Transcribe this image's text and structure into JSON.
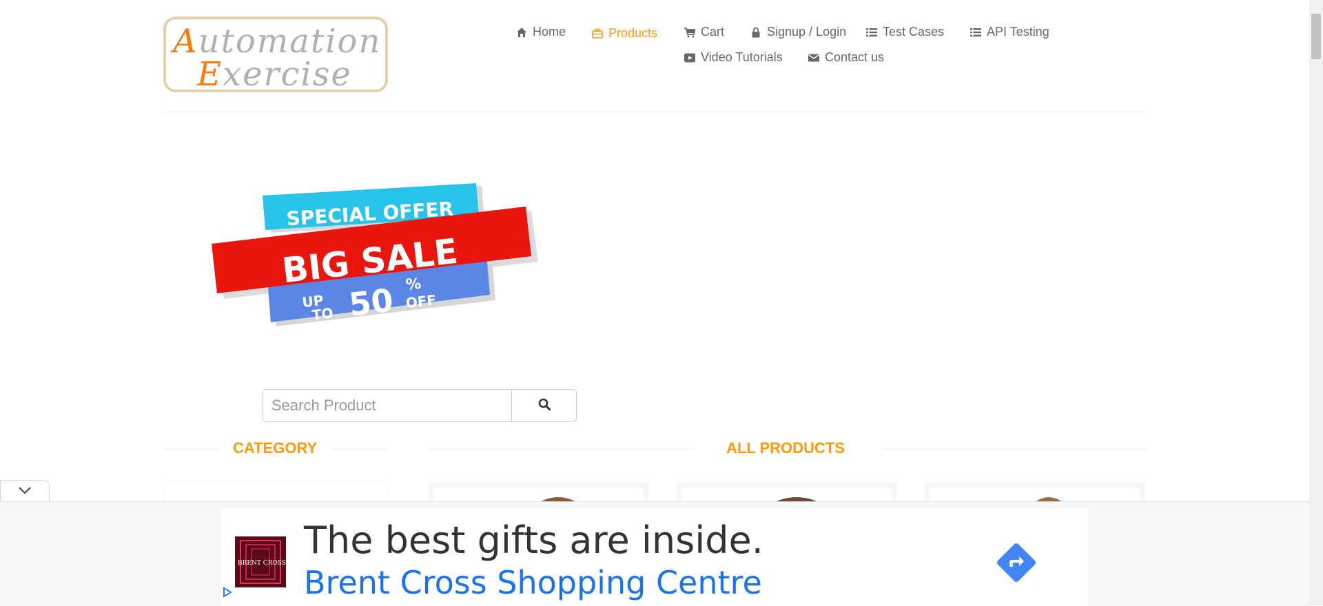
{
  "logo": {
    "line1_cap": "A",
    "line1_rest": "utomation",
    "line2_cap": "E",
    "line2_rest": "xercise"
  },
  "nav": {
    "items": [
      {
        "label": "Home",
        "icon": "home-icon"
      },
      {
        "label": "Products",
        "icon": "briefcase-icon",
        "active": true
      },
      {
        "label": "Cart",
        "icon": "cart-icon"
      },
      {
        "label": "Signup / Login",
        "icon": "lock-icon"
      },
      {
        "label": "Test Cases",
        "icon": "list-icon"
      },
      {
        "label": "API Testing",
        "icon": "list-icon"
      },
      {
        "label": "Video Tutorials",
        "icon": "youtube-play-icon"
      },
      {
        "label": "Contact us",
        "icon": "envelope-icon"
      }
    ]
  },
  "sale_banner": {
    "line1": "SPECIAL OFFER",
    "line2": "BIG SALE",
    "up": "UP",
    "to": "TO",
    "percent_value": "50",
    "percent_sign": "%",
    "off": "OFF"
  },
  "search": {
    "placeholder": "Search Product",
    "value": ""
  },
  "sections": {
    "category_title": "CATEGORY",
    "products_title": "ALL PRODUCTS"
  },
  "ad": {
    "headline": "The best gifts are inside.",
    "advertiser": "Brent Cross Shopping Centre",
    "thumb_text": "BRENT CROSS"
  },
  "colors": {
    "accent": "#fe980f",
    "text": "#696763",
    "ad_link": "#1a73e8",
    "banner_cyan": "#29c3ea",
    "banner_red": "#e8160c",
    "banner_blue": "#5b86e5"
  }
}
